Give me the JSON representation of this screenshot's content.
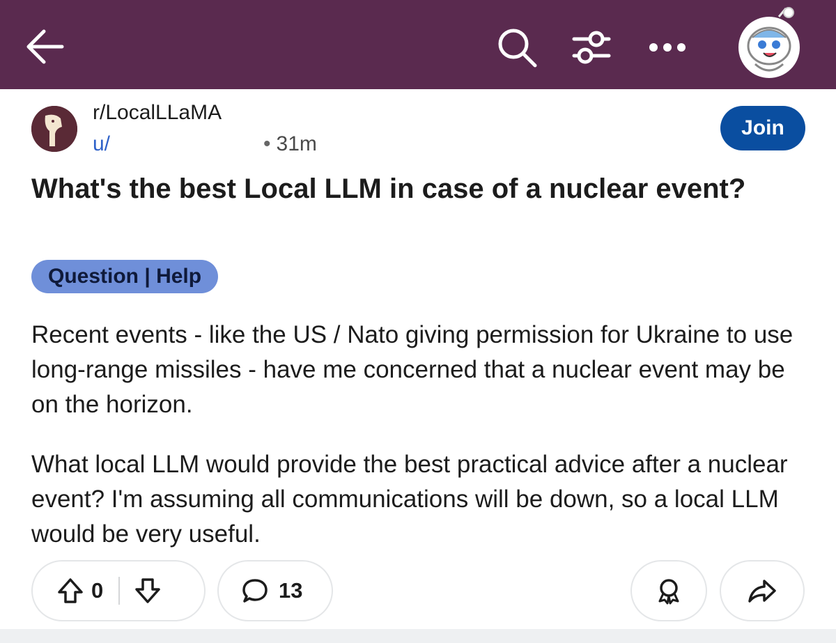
{
  "colors": {
    "topbar": "#5a2a4f",
    "join_button": "#0a4ea0",
    "flair": "#6f8fd9",
    "author_link": "#2f62c9"
  },
  "topbar": {
    "icons": [
      "back-arrow-icon",
      "search-icon",
      "filter-icon",
      "more-icon",
      "user-avatar"
    ]
  },
  "post": {
    "subreddit": "r/LocalLLaMA",
    "author_prefix": "u/",
    "time_separator": "•",
    "time_ago": "31m",
    "join_label": "Join",
    "title": "What's the best Local LLM in case of a nuclear event?",
    "flair": "Question | Help",
    "body": [
      "Recent events - like the US / Nato giving permission for Ukraine to use long-range missiles - have me concerned that a nuclear event may be on the horizon.",
      "What local LLM would provide the best practical advice after a nuclear event? I'm assuming all communications will be down, so a local LLM would be very useful."
    ]
  },
  "actions": {
    "vote_count": "0",
    "comment_count": "13"
  }
}
